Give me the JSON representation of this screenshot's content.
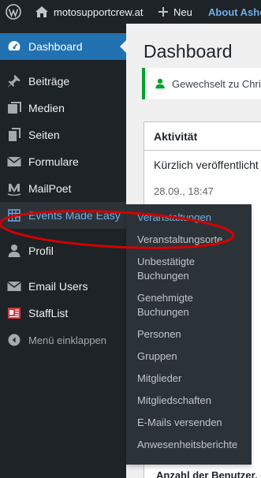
{
  "adminbar": {
    "site_name": "motosupportcrew.at",
    "new_label": "Neu",
    "about_label": "About Ashe"
  },
  "sidebar": {
    "items": [
      {
        "label": "Dashboard",
        "icon": "dashboard-icon"
      },
      {
        "label": "Beiträge",
        "icon": "pin-icon"
      },
      {
        "label": "Medien",
        "icon": "media-icon"
      },
      {
        "label": "Seiten",
        "icon": "pages-icon"
      },
      {
        "label": "Formulare",
        "icon": "envelope-icon"
      },
      {
        "label": "MailPoet",
        "icon": "mailpoet-icon"
      },
      {
        "label": "Events Made Easy",
        "icon": "calendar-grid-icon"
      },
      {
        "label": "Profil",
        "icon": "user-icon"
      },
      {
        "label": "Email Users",
        "icon": "envelope-icon"
      },
      {
        "label": "StaffList",
        "icon": "id-card-icon"
      },
      {
        "label": "Menü einklappen",
        "icon": "collapse-icon"
      }
    ]
  },
  "main": {
    "page_title": "Dashboard",
    "notice_text": "Gewechselt zu Chri",
    "activity": {
      "title": "Aktivität",
      "recent": "Kürzlich veröffentlicht",
      "date": "28.09., 18:47",
      "bottom": "Anzahl der Benutzer, d"
    }
  },
  "flyout": {
    "items": [
      "Veranstaltungen",
      "Veranstaltungsorte",
      "Unbestätigte Buchungen",
      "Genehmigte Buchungen",
      "Personen",
      "Gruppen",
      "Mitglieder",
      "Mitgliedschaften",
      "E-Mails versenden",
      "Anwesenheitsberichte"
    ]
  },
  "colors": {
    "admin_dark": "#1d2327",
    "menu_current": "#2271b1",
    "flyout_bg": "#2c3338",
    "link_blue": "#72aee6",
    "annotation_red": "#d40000"
  }
}
